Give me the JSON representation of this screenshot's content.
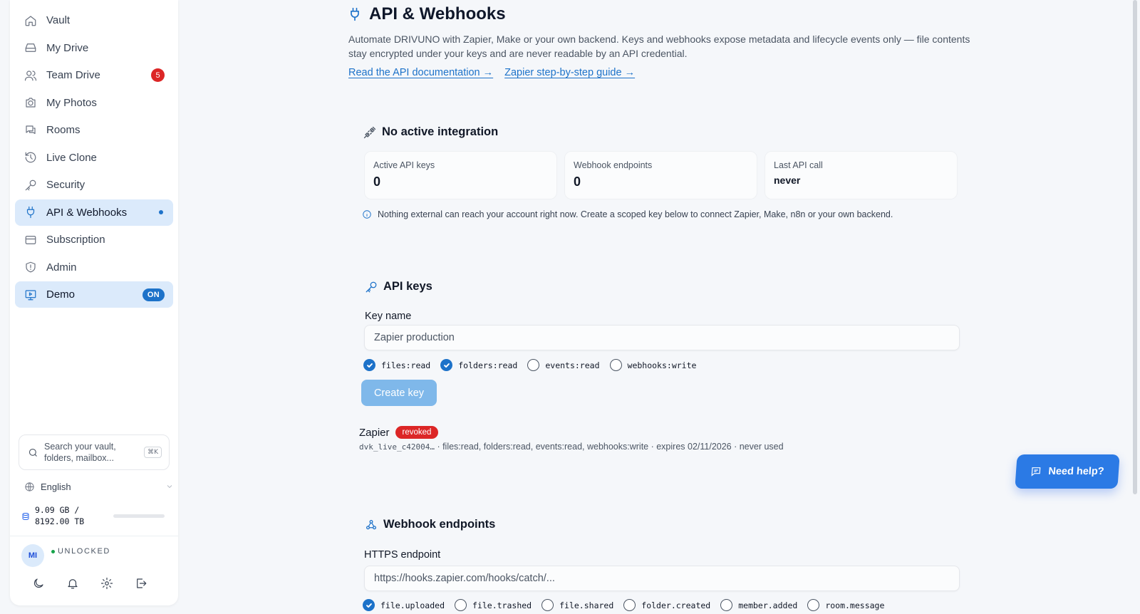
{
  "sidebar": {
    "items": [
      {
        "label": "Vault",
        "icon": "home-icon"
      },
      {
        "label": "My Drive",
        "icon": "drive-icon"
      },
      {
        "label": "Team Drive",
        "icon": "users-icon",
        "badge": "5"
      },
      {
        "label": "My Photos",
        "icon": "camera-icon"
      },
      {
        "label": "Rooms",
        "icon": "chat-icon"
      },
      {
        "label": "Live Clone",
        "icon": "history-icon"
      },
      {
        "label": "Security",
        "icon": "key-icon"
      },
      {
        "label": "API & Webhooks",
        "icon": "plug-icon",
        "active": true
      },
      {
        "label": "Subscription",
        "icon": "card-icon"
      },
      {
        "label": "Admin",
        "icon": "shield-icon"
      },
      {
        "label": "Demo",
        "icon": "monitor-play-icon",
        "badge": "ON"
      }
    ],
    "search_line1": "Search your vault,",
    "search_line2": "folders, mailbox...",
    "search_shortcut": "⌘K",
    "language": "English",
    "storage_line1": "9.09 GB /",
    "storage_line2": "8192.00 TB",
    "storage_fraction": 0.001,
    "user_initials": "MI",
    "user_status": "UNLOCKED"
  },
  "main": {
    "title": "API & Webhooks",
    "description": "Automate DRIVUNO with Zapier, Make or your own backend. Keys and webhooks expose metadata and lifecycle events only — file contents stay encrypted under your keys and are never readable by an API credential.",
    "link_docs": "Read the API documentation →",
    "link_zapier": "Zapier step-by-step guide →",
    "integration": {
      "title": "No active integration",
      "stats": [
        {
          "label": "Active API keys",
          "value": "0"
        },
        {
          "label": "Webhook endpoints",
          "value": "0"
        },
        {
          "label": "Last API call",
          "value": "never"
        }
      ],
      "info": "Nothing external can reach your account right now. Create a scoped key below to connect Zapier, Make, n8n or your own backend."
    },
    "api_keys": {
      "title": "API keys",
      "key_name_label": "Key name",
      "key_name_placeholder": "Zapier production",
      "scopes": [
        {
          "label": "files:read",
          "checked": true
        },
        {
          "label": "folders:read",
          "checked": true
        },
        {
          "label": "events:read",
          "checked": false
        },
        {
          "label": "webhooks:write",
          "checked": false
        }
      ],
      "create_label": "Create key",
      "existing": {
        "name": "Zapier",
        "status": "revoked",
        "prefix": "dvk_live_c42004…",
        "meta": " · files:read, folders:read, events:read, webhooks:write · expires 02/11/2026 · never used"
      }
    },
    "webhooks": {
      "title": "Webhook endpoints",
      "endpoint_label": "HTTPS endpoint",
      "endpoint_placeholder": "https://hooks.zapier.com/hooks/catch/...",
      "events": [
        {
          "label": "file.uploaded",
          "checked": true
        },
        {
          "label": "file.trashed",
          "checked": false
        },
        {
          "label": "file.shared",
          "checked": false
        },
        {
          "label": "folder.created",
          "checked": false
        },
        {
          "label": "member.added",
          "checked": false
        },
        {
          "label": "room.message",
          "checked": false
        }
      ]
    }
  },
  "help_label": "Need help?",
  "colors": {
    "accent": "#1d72c9",
    "danger": "#dc2626",
    "active_bg": "#dbeafb"
  }
}
